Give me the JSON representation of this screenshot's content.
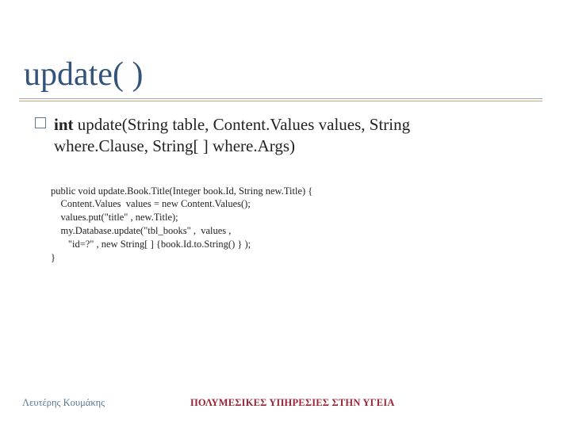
{
  "title": "update( )",
  "signature": {
    "keyword": "int",
    "rest_line1": "  update(String table, Content.Values values, String",
    "rest_line2": "where.Clause, String[ ] where.Args)"
  },
  "code": "public void update.Book.Title(Integer book.Id, String new.Title) {\n    Content.Values  values = new Content.Values();\n    values.put(\"title\" , new.Title);\n    my.Database.update(\"tbl_books\" ,  values ,\n       \"id=?\" , new String[ ] {book.Id.to.String() } );\n}",
  "footer": {
    "author": "Λευτέρης Κουμάκης",
    "subject": "ΠΟΛΥΜΕΣΙΚΕΣ ΥΠΗΡΕΣΙΕΣ ΣΤΗΝ ΥΓΕΙΑ"
  }
}
